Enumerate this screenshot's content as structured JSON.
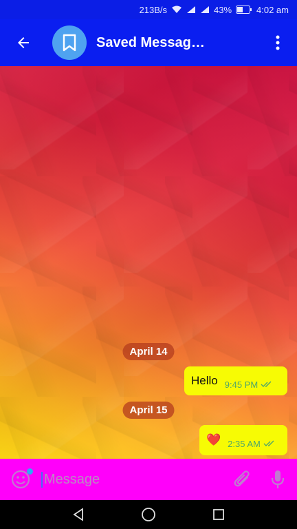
{
  "status_bar": {
    "net_speed": "213B/s",
    "battery": "43%",
    "time": "4:02 am"
  },
  "header": {
    "title": "Saved Messag…",
    "avatar_icon": "bookmark-icon",
    "back_icon": "arrow-left-icon",
    "menu_icon": "more-vert-icon"
  },
  "chat": {
    "dates": [
      "April 14",
      "April 15"
    ],
    "messages": [
      {
        "text": "Hello",
        "time": "9:45 PM",
        "status": "read"
      },
      {
        "text": "❤️",
        "time": "2:35 AM",
        "status": "read"
      }
    ]
  },
  "composer": {
    "placeholder": "Message",
    "value": ""
  },
  "colors": {
    "status_bar": "#0b1ee6",
    "app_bar": "#0a1ef0",
    "avatar": "#4fa3f0",
    "bubble": "#f7fb04",
    "input_bar": "#ff00fa",
    "check": "#4fa56a"
  }
}
